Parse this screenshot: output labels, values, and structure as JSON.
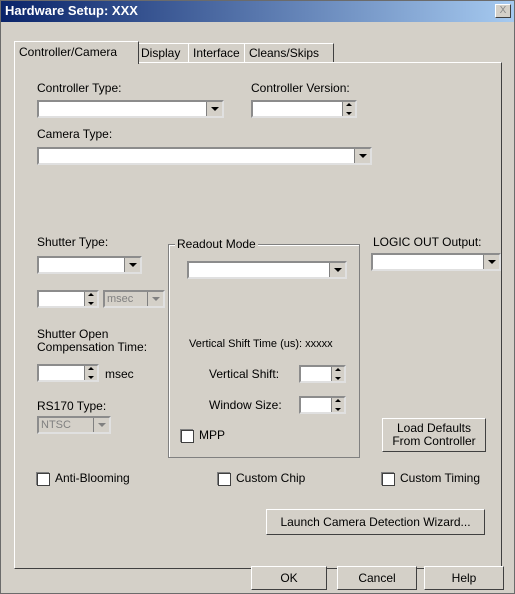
{
  "window": {
    "title": "Hardware Setup:  XXX",
    "close_glyph": "X"
  },
  "tabs": [
    {
      "label": "Controller/Camera",
      "active": true
    },
    {
      "label": "Display",
      "active": false
    },
    {
      "label": "Interface",
      "active": false
    },
    {
      "label": "Cleans/Skips",
      "active": false
    }
  ],
  "controller": {
    "type_label": "Controller Type:",
    "type_value": "",
    "version_label": "Controller Version:",
    "version_value": "",
    "camera_type_label": "Camera Type:",
    "camera_type_value": ""
  },
  "shutter": {
    "type_label": "Shutter Type:",
    "type_value": "",
    "time_value": "",
    "time_unit": "msec",
    "comp_label_line1": "Shutter Open",
    "comp_label_line2": "Compensation Time:",
    "comp_value": "",
    "comp_unit": "msec"
  },
  "readout": {
    "group_label": "Readout Mode",
    "mode_value": "",
    "vertical_shift_time_label": "Vertical Shift Time (us):  xxxxx",
    "vertical_shift_label": "Vertical Shift:",
    "vertical_shift_value": "",
    "window_size_label": "Window Size:",
    "window_size_value": "",
    "mpp_label": "MPP"
  },
  "logic_out": {
    "label": "LOGIC OUT Output:",
    "value": ""
  },
  "rs170": {
    "label": "RS170 Type:",
    "value": "NTSC"
  },
  "buttons": {
    "load_defaults_line1": "Load Defaults",
    "load_defaults_line2": "From Controller",
    "launch_wizard": "Launch Camera Detection Wizard...",
    "ok": "OK",
    "cancel": "Cancel",
    "help": "Help"
  },
  "checkboxes": {
    "anti_blooming": "Anti-Blooming",
    "custom_chip": "Custom Chip",
    "custom_timing": "Custom Timing"
  }
}
